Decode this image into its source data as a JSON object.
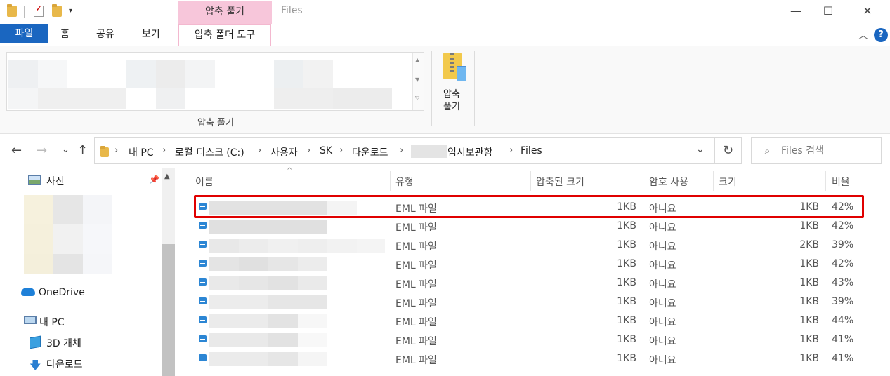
{
  "titlebar": {
    "context_tab": "압축 풀기",
    "window_title": "Files",
    "minimize": "—",
    "maximize": "☐",
    "close": "✕",
    "qa_dropdown": "▾"
  },
  "ribbon_tabs": {
    "file": "파일",
    "home": "홈",
    "share": "공유",
    "view": "보기",
    "compressed_tools": "압축 폴더 도구",
    "collapse": "︿",
    "help": "?"
  },
  "ribbon": {
    "group_label": "압축 풀기",
    "extract_all_line1": "압축",
    "extract_all_line2": "풀기"
  },
  "address": {
    "crumbs": [
      "내 PC",
      "로컬 디스크 (C:)",
      "사용자",
      "SK",
      "다운로드",
      "임시보관함",
      "Files"
    ],
    "sep": "›",
    "dropdown": "⌄",
    "refresh": "↻"
  },
  "search": {
    "placeholder": "Files 검색",
    "icon": "⌕"
  },
  "nav_buttons": {
    "back": "←",
    "forward": "→",
    "recent": "⌄",
    "up": "↑"
  },
  "navpane": {
    "photos": "사진",
    "onedrive": "OneDrive",
    "this_pc": "내 PC",
    "objects_3d": "3D 개체",
    "downloads": "다운로드",
    "pin": "📌",
    "scroll_up": "▲"
  },
  "columns": {
    "name": "이름",
    "type": "유형",
    "compressed_size": "압축된 크기",
    "encrypted": "암호 사용",
    "size": "크기",
    "ratio": "비율",
    "sort_indicator": "^"
  },
  "files": [
    {
      "type": "EML 파일",
      "compressed_size": "1KB",
      "encrypted": "아니요",
      "size": "1KB",
      "ratio": "42%"
    },
    {
      "type": "EML 파일",
      "compressed_size": "1KB",
      "encrypted": "아니요",
      "size": "1KB",
      "ratio": "42%"
    },
    {
      "type": "EML 파일",
      "compressed_size": "1KB",
      "encrypted": "아니요",
      "size": "2KB",
      "ratio": "39%"
    },
    {
      "type": "EML 파일",
      "compressed_size": "1KB",
      "encrypted": "아니요",
      "size": "1KB",
      "ratio": "42%"
    },
    {
      "type": "EML 파일",
      "compressed_size": "1KB",
      "encrypted": "아니요",
      "size": "1KB",
      "ratio": "43%"
    },
    {
      "type": "EML 파일",
      "compressed_size": "1KB",
      "encrypted": "아니요",
      "size": "1KB",
      "ratio": "39%"
    },
    {
      "type": "EML 파일",
      "compressed_size": "1KB",
      "encrypted": "아니요",
      "size": "1KB",
      "ratio": "44%"
    },
    {
      "type": "EML 파일",
      "compressed_size": "1KB",
      "encrypted": "아니요",
      "size": "1KB",
      "ratio": "41%"
    },
    {
      "type": "EML 파일",
      "compressed_size": "1KB",
      "encrypted": "아니요",
      "size": "1KB",
      "ratio": "41%"
    }
  ],
  "colors": {
    "accent": "#1a66c0",
    "context_tab": "#f7c6da",
    "highlight": "#e00000"
  }
}
